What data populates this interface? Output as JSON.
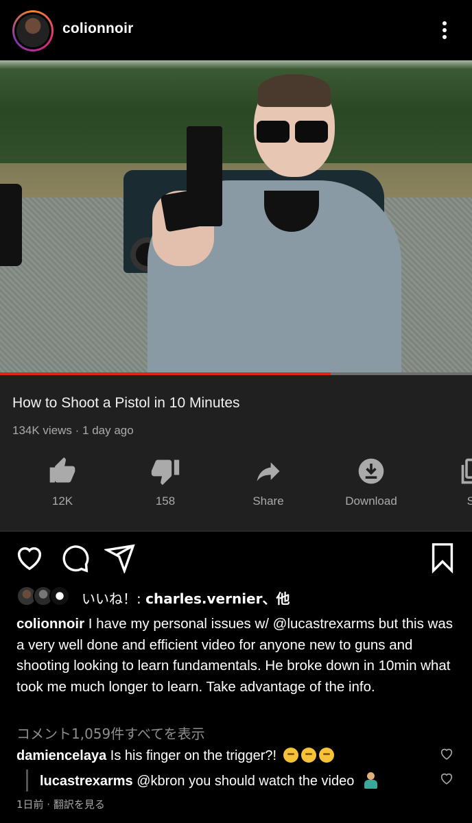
{
  "header": {
    "username": "colionnoir"
  },
  "video": {
    "progress": 0.7
  },
  "youtube": {
    "title": "How to Shoot a Pistol in 10 Minutes",
    "meta": "134K views · 1 day ago",
    "actions": [
      {
        "icon": "thumbs-up-icon",
        "label": "12K"
      },
      {
        "icon": "thumbs-down-icon",
        "label": "158"
      },
      {
        "icon": "share-arrow-icon",
        "label": "Share"
      },
      {
        "icon": "download-icon",
        "label": "Download"
      },
      {
        "icon": "save-icon",
        "label": "Sa"
      }
    ]
  },
  "post": {
    "icons": [
      "heart-icon",
      "comment-icon",
      "send-icon",
      "bookmark-icon"
    ],
    "likes_prefix": "いいね！: ",
    "likes_user": "charles.vernier",
    "likes_suffix": "、他",
    "caption_user": "colionnoir",
    "caption_text": " I have my personal issues w/ @lucastrexarms but this was a very well done and efficient video for anyone new to guns and shooting looking to learn fundamentals. He broke down in 10min what took me much longer to learn. Take advantage of the info.",
    "view_all_comments": "コメント1,059件すべてを表示",
    "comments": [
      {
        "user": "damiencelaya",
        "text": " Is his finger on the trigger?! ",
        "emoji": "thinking-face-emoji"
      },
      {
        "user": "lucastrexarms",
        "text": " @kbron you should watch the video ",
        "emoji": "person-shrugging-emoji"
      }
    ],
    "time_and_translate": "1日前 · 翻訳を見る"
  },
  "colors": {
    "accent_red": "#e62117",
    "panel_bg": "#202020",
    "muted_text": "#aaaaaa"
  }
}
